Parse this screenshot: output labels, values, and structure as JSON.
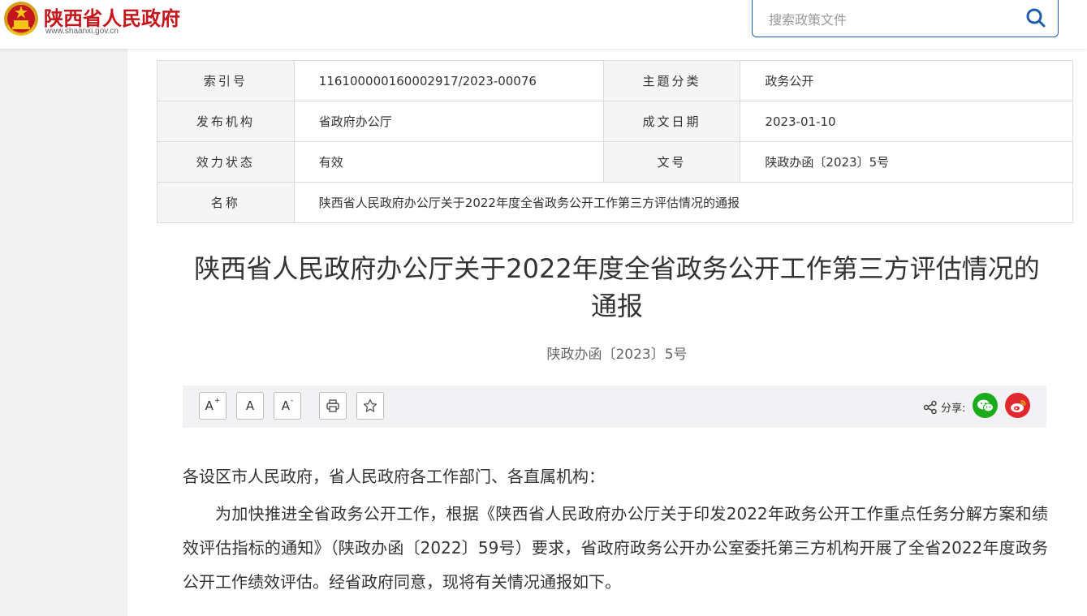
{
  "header": {
    "site_name": "陕西省人民政府",
    "site_url": "www.shaanxi.gov.cn",
    "search_placeholder": "搜索政策文件"
  },
  "meta": {
    "rows": [
      [
        {
          "label": "索引号",
          "value": "11610000016000291 7/2023-00076"
        },
        {
          "label": "主题分类",
          "value": "政务公开"
        }
      ],
      [
        {
          "label": "发布机构",
          "value": "省政府办公厅"
        },
        {
          "label": "成文日期",
          "value": "2023-01-10"
        }
      ],
      [
        {
          "label": "效力状态",
          "value": "有效"
        },
        {
          "label": "文号",
          "value": "陕政办函〔2023〕5号"
        }
      ]
    ],
    "index_label": "索引号",
    "index_value": "116100000160002917/2023-00076",
    "topic_label": "主题分类",
    "topic_value": "政务公开",
    "publisher_label": "发布机构",
    "publisher_value": "省政府办公厅",
    "date_label": "成文日期",
    "date_value": "2023-01-10",
    "status_label": "效力状态",
    "status_value": "有效",
    "docno_label": "文号",
    "docno_value": "陕政办函〔2023〕5号",
    "name_label": "名称",
    "name_value": "陕西省人民政府办公厅关于2022年度全省政务公开工作第三方评估情况的通报"
  },
  "article": {
    "title": "陕西省人民政府办公厅关于2022年度全省政务公开工作第三方评估情况的通报",
    "doc_number": "陕政办函〔2023〕5号",
    "salutation": "各设区市人民政府，省人民政府各工作部门、各直属机构：",
    "paragraph1": "为加快推进全省政务公开工作，根据《陕西省人民政府办公厅关于印发2022年政务公开工作重点任务分解方案和绩效评估指标的通知》（陕政办函〔2022〕59号）要求，省政府政务公开办公室委托第三方机构开展了全省2022年度政务公开工作绩效评估。经省政府同意，现将有关情况通报如下。"
  },
  "toolbar": {
    "font_large": "A",
    "font_large_sup": "+",
    "font_normal": "A",
    "font_small": "A",
    "font_small_sup": "-",
    "share_label": "分享:"
  },
  "colors": {
    "brand_red": "#c4161c",
    "search_border": "#1f5ca9",
    "wechat_green": "#1aac19",
    "weibo_red": "#e0282e"
  },
  "icons": [
    "national-emblem-icon",
    "search-icon",
    "print-icon",
    "star-icon",
    "share-icon",
    "wechat-icon",
    "weibo-icon"
  ]
}
